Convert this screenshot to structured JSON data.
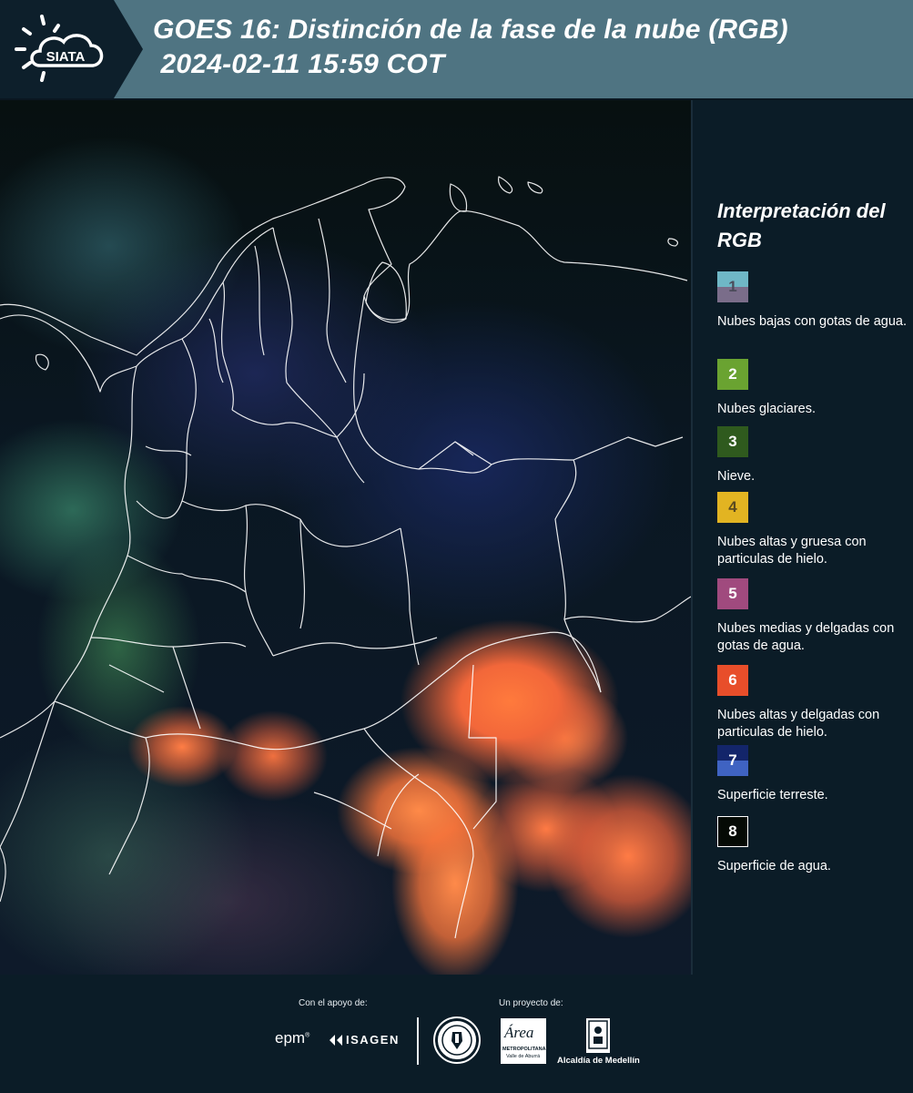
{
  "header": {
    "logo_text": "SIATA",
    "title": "GOES 16: Distinción de la fase de la nube (RGB)\n 2024-02-11 15:59 COT"
  },
  "legend": {
    "title": "Interpretación del RGB",
    "items": [
      {
        "number": "1",
        "label": "Nubes bajas con gotas de agua.",
        "color_top": "#6fb7c6",
        "color_bottom": "#7a6d8a",
        "text_color": "#4b4b5a"
      },
      {
        "number": "2",
        "label": "Nubes glaciares.",
        "color_top": "#6aa331",
        "color_bottom": "#6aa331",
        "text_color": "#ffffff"
      },
      {
        "number": "3",
        "label": "Nieve.",
        "color_top": "#2f5a1e",
        "color_bottom": "#2f5a1e",
        "text_color": "#ffffff"
      },
      {
        "number": "4",
        "label": "Nubes altas y gruesa con particulas de hielo.",
        "color_top": "#e2b422",
        "color_bottom": "#e2b422",
        "text_color": "#5a4a20"
      },
      {
        "number": "5",
        "label": "Nubes medias y delgadas con gotas de agua.",
        "color_top": "#a04a7e",
        "color_bottom": "#a04a7e",
        "text_color": "#ffffff"
      },
      {
        "number": "6",
        "label": "Nubes altas y delgadas con particulas de hielo.",
        "color_top": "#e84e2a",
        "color_bottom": "#e84e2a",
        "text_color": "#ffffff"
      },
      {
        "number": "7",
        "label": "Superficie terreste.",
        "color_top": "#13256a",
        "color_bottom": "#3f63c2",
        "text_color": "#ffffff"
      },
      {
        "number": "8",
        "label": "Superficie de agua.",
        "color_top": "#050a05",
        "color_bottom": "#050a05",
        "text_color": "#ffffff"
      }
    ]
  },
  "footer": {
    "support_label": "Con el apoyo de:",
    "project_label": "Un proyecto de:",
    "epm": "epm",
    "isagen": "ISAGEN",
    "area_name": "Área",
    "area_sub1": "METROPOLITANA",
    "area_sub2": "Valle de Aburrá",
    "alcaldia": "Alcaldía de Medellín"
  }
}
